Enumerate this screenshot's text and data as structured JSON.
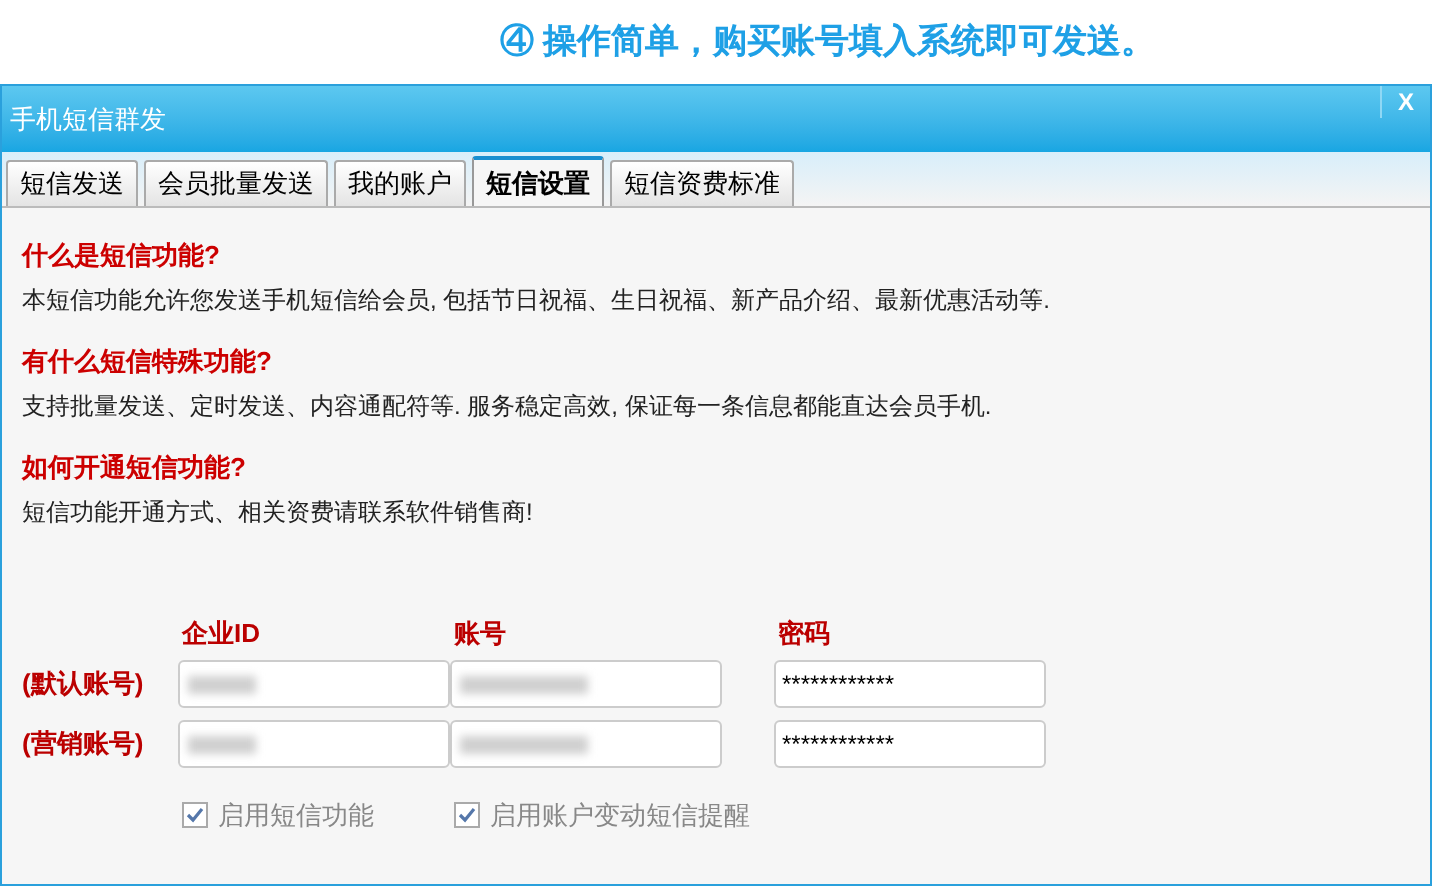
{
  "banner": "④ 操作简单，购买账号填入系统即可发送。",
  "window": {
    "title": "手机短信群发",
    "close": "X"
  },
  "tabs": [
    {
      "label": "短信发送",
      "selected": false
    },
    {
      "label": "会员批量发送",
      "selected": false
    },
    {
      "label": "我的账户",
      "selected": false
    },
    {
      "label": "短信设置",
      "selected": true
    },
    {
      "label": "短信资费标准",
      "selected": false
    }
  ],
  "sections": [
    {
      "heading": "什么是短信功能?",
      "text": "本短信功能允许您发送手机短信给会员, 包括节日祝福、生日祝福、新产品介绍、最新优惠活动等."
    },
    {
      "heading": "有什么短信特殊功能?",
      "text": "支持批量发送、定时发送、内容通配符等. 服务稳定高效, 保证每一条信息都能直达会员手机."
    },
    {
      "heading": "如何开通短信功能?",
      "text": "短信功能开通方式、相关资费请联系软件销售商!"
    }
  ],
  "accounts": {
    "columns": [
      "企业ID",
      "账号",
      "密码"
    ],
    "rows": [
      {
        "label": "(默认账号)",
        "password": "************"
      },
      {
        "label": "(营销账号)",
        "password": "************"
      }
    ]
  },
  "options": [
    {
      "label": "启用短信功能",
      "checked": true,
      "disabled": true
    },
    {
      "label": "启用账户变动短信提醒",
      "checked": true,
      "disabled": true
    }
  ]
}
